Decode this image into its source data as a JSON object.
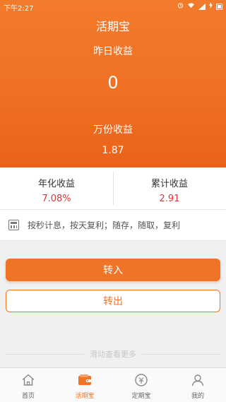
{
  "status_bar": {
    "time": "下午2:27"
  },
  "header": {
    "title": "活期宝"
  },
  "summary": {
    "yesterday_label": "昨日收益",
    "yesterday_value": "0",
    "per_10k_label": "万份收益",
    "per_10k_value": "1.87"
  },
  "stats": {
    "annual_label": "年化收益",
    "annual_value": "7.08%",
    "total_label": "累计收益",
    "total_value": "2.91"
  },
  "rule": {
    "text": "按秒计息，按天复利；随存，随取，复利"
  },
  "buttons": {
    "transfer_in": "转入",
    "transfer_out": "转出"
  },
  "more_hint": "滑动查看更多",
  "tabs": [
    {
      "label": "首页",
      "icon": "home-icon"
    },
    {
      "label": "活期宝",
      "icon": "wallet-icon",
      "active": true
    },
    {
      "label": "定期宝",
      "icon": "fixed-deposit-icon"
    },
    {
      "label": "我的",
      "icon": "profile-icon"
    }
  ],
  "colors": {
    "accent": "#f07426",
    "value_red": "#d9383a"
  }
}
